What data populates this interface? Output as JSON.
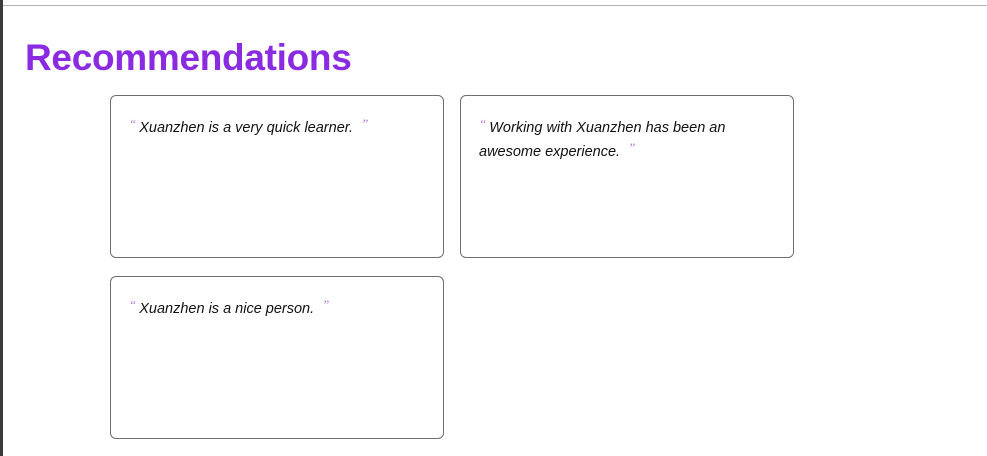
{
  "section": {
    "title": "Recommendations"
  },
  "recommendations": [
    {
      "text": "Xuanzhen is a very quick learner."
    },
    {
      "text": "Working with Xuanzhen has been an awesome experience."
    },
    {
      "text": "Xuanzhen is a nice person."
    }
  ],
  "quote_marks": {
    "open": "“",
    "close": "”"
  },
  "colors": {
    "title": "#8a2be2",
    "quote_mark": "#b07fd8",
    "card_border": "#6e6e6e"
  }
}
